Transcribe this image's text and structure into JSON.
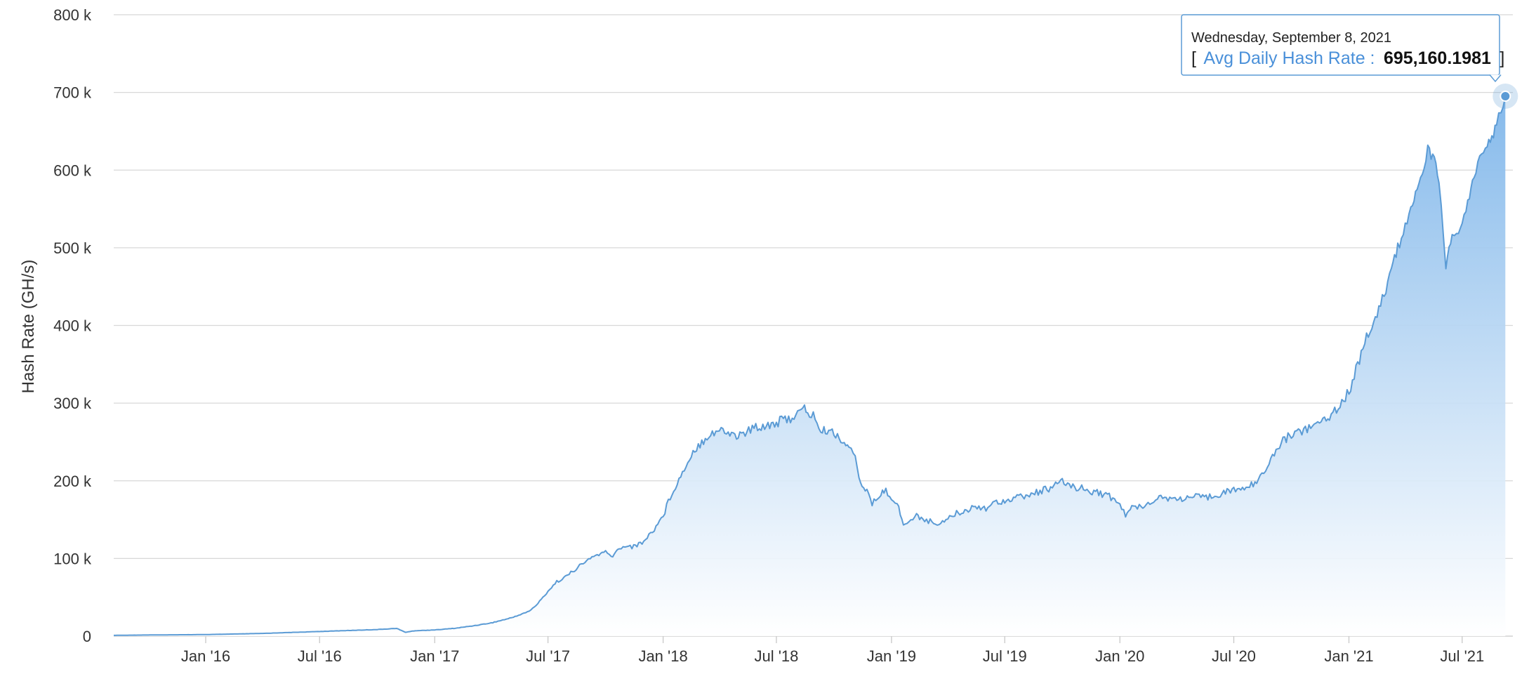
{
  "colors": {
    "line": "#5b9bd5",
    "area_top": "#7fb6ea",
    "area_bottom": "#ffffff",
    "grid": "#d8d8d8",
    "marker": "#5b9bd5",
    "tooltip_border": "#5b9bd5"
  },
  "tooltip": {
    "date": "Wednesday, September 8, 2021",
    "open_bracket": "[",
    "series_label": "Avg Daily Hash Rate :",
    "value": "695,160.1981",
    "close_bracket": "]"
  },
  "chart_data": {
    "type": "area",
    "title": "",
    "xlabel": "",
    "ylabel": "Hash Rate (GH/s)",
    "ylim": [
      0,
      800000
    ],
    "xlim": [
      "2015-08-07",
      "2021-09-20"
    ],
    "grid": true,
    "y_ticks": [
      {
        "value": 0,
        "label": "0"
      },
      {
        "value": 100000,
        "label": "100 k"
      },
      {
        "value": 200000,
        "label": "200 k"
      },
      {
        "value": 300000,
        "label": "300 k"
      },
      {
        "value": 400000,
        "label": "400 k"
      },
      {
        "value": 500000,
        "label": "500 k"
      },
      {
        "value": 600000,
        "label": "600 k"
      },
      {
        "value": 700000,
        "label": "700 k"
      },
      {
        "value": 800000,
        "label": "800 k"
      }
    ],
    "x_ticks": [
      {
        "date": "2016-01-01",
        "label": "Jan '16"
      },
      {
        "date": "2016-07-01",
        "label": "Jul '16"
      },
      {
        "date": "2017-01-01",
        "label": "Jan '17"
      },
      {
        "date": "2017-07-01",
        "label": "Jul '17"
      },
      {
        "date": "2018-01-01",
        "label": "Jan '18"
      },
      {
        "date": "2018-07-01",
        "label": "Jul '18"
      },
      {
        "date": "2019-01-01",
        "label": "Jan '19"
      },
      {
        "date": "2019-07-01",
        "label": "Jul '19"
      },
      {
        "date": "2020-01-01",
        "label": "Jan '20"
      },
      {
        "date": "2020-07-01",
        "label": "Jul '20"
      },
      {
        "date": "2021-01-01",
        "label": "Jan '21"
      },
      {
        "date": "2021-07-01",
        "label": "Jul '21"
      }
    ],
    "series": [
      {
        "x": [
          "2015-08-07",
          "2015-10-01",
          "2016-01-01",
          "2016-04-01",
          "2016-07-01",
          "2016-10-01",
          "2016-11-01",
          "2016-11-15",
          "2016-12-01",
          "2017-01-01",
          "2017-02-01",
          "2017-03-01",
          "2017-04-01",
          "2017-05-01",
          "2017-05-15",
          "2017-06-01",
          "2017-06-15",
          "2017-07-01",
          "2017-07-15",
          "2017-08-01",
          "2017-08-15",
          "2017-09-01",
          "2017-09-15",
          "2017-10-01",
          "2017-10-10",
          "2017-10-20",
          "2017-11-01",
          "2017-11-15",
          "2017-12-01",
          "2017-12-15",
          "2018-01-01",
          "2018-01-15",
          "2018-02-01",
          "2018-02-15",
          "2018-03-01",
          "2018-03-15",
          "2018-04-01",
          "2018-04-15",
          "2018-05-01",
          "2018-05-15",
          "2018-06-01",
          "2018-06-15",
          "2018-07-01",
          "2018-07-15",
          "2018-08-01",
          "2018-08-10",
          "2018-08-15",
          "2018-08-20",
          "2018-09-01",
          "2018-09-10",
          "2018-09-20",
          "2018-10-01",
          "2018-10-15",
          "2018-10-25",
          "2018-11-01",
          "2018-11-10",
          "2018-11-20",
          "2018-12-01",
          "2018-12-10",
          "2018-12-20",
          "2019-01-01",
          "2019-01-10",
          "2019-01-20",
          "2019-02-01",
          "2019-02-10",
          "2019-02-20",
          "2019-03-01",
          "2019-03-15",
          "2019-04-01",
          "2019-04-15",
          "2019-05-01",
          "2019-05-15",
          "2019-06-01",
          "2019-06-15",
          "2019-07-01",
          "2019-07-15",
          "2019-08-01",
          "2019-08-15",
          "2019-09-01",
          "2019-09-15",
          "2019-10-01",
          "2019-10-15",
          "2019-11-01",
          "2019-11-15",
          "2019-12-01",
          "2019-12-15",
          "2020-01-01",
          "2020-01-10",
          "2020-01-20",
          "2020-02-01",
          "2020-02-15",
          "2020-03-01",
          "2020-03-15",
          "2020-04-01",
          "2020-04-15",
          "2020-05-01",
          "2020-05-15",
          "2020-06-01",
          "2020-06-15",
          "2020-07-01",
          "2020-07-15",
          "2020-08-01",
          "2020-08-15",
          "2020-09-01",
          "2020-09-15",
          "2020-10-01",
          "2020-10-15",
          "2020-11-01",
          "2020-11-15",
          "2020-12-01",
          "2020-12-15",
          "2021-01-01",
          "2021-01-15",
          "2021-02-01",
          "2021-02-15",
          "2021-03-01",
          "2021-03-10",
          "2021-03-20",
          "2021-04-01",
          "2021-04-10",
          "2021-04-20",
          "2021-05-01",
          "2021-05-07",
          "2021-05-15",
          "2021-05-20",
          "2021-05-25",
          "2021-06-01",
          "2021-06-05",
          "2021-06-10",
          "2021-06-15",
          "2021-06-22",
          "2021-07-01",
          "2021-07-10",
          "2021-07-20",
          "2021-08-01",
          "2021-08-10",
          "2021-08-20",
          "2021-08-25",
          "2021-09-01",
          "2021-09-08"
        ],
        "y": [
          1000,
          1500,
          2000,
          3500,
          6000,
          8500,
          10000,
          5000,
          7000,
          8000,
          10000,
          13000,
          17000,
          23000,
          27000,
          32000,
          42000,
          58000,
          70000,
          78000,
          87000,
          97000,
          104000,
          108000,
          102000,
          110000,
          117000,
          115000,
          122000,
          135000,
          155000,
          185000,
          210000,
          235000,
          248000,
          260000,
          265000,
          262000,
          258000,
          263000,
          270000,
          272000,
          275000,
          278000,
          285000,
          288000,
          293000,
          288000,
          282000,
          262000,
          265000,
          262000,
          252000,
          242000,
          238000,
          205000,
          190000,
          170000,
          178000,
          188000,
          180000,
          170000,
          145000,
          148000,
          155000,
          152000,
          148000,
          145000,
          152000,
          158000,
          162000,
          168000,
          165000,
          172000,
          175000,
          178000,
          180000,
          183000,
          188000,
          192000,
          198000,
          194000,
          190000,
          187000,
          184000,
          180000,
          170000,
          155000,
          165000,
          168000,
          170000,
          180000,
          178000,
          176000,
          178000,
          179000,
          178000,
          182000,
          185000,
          188000,
          190000,
          195000,
          210000,
          230000,
          250000,
          260000,
          265000,
          268000,
          275000,
          285000,
          295000,
          315000,
          350000,
          390000,
          415000,
          445000,
          475000,
          500000,
          525000,
          555000,
          575000,
          600000,
          630000,
          615000,
          610000,
          580000,
          520000,
          480000,
          495000,
          510000,
          520000,
          535000,
          555000,
          590000,
          620000,
          630000,
          640000,
          665000,
          680000,
          695160
        ]
      }
    ]
  }
}
